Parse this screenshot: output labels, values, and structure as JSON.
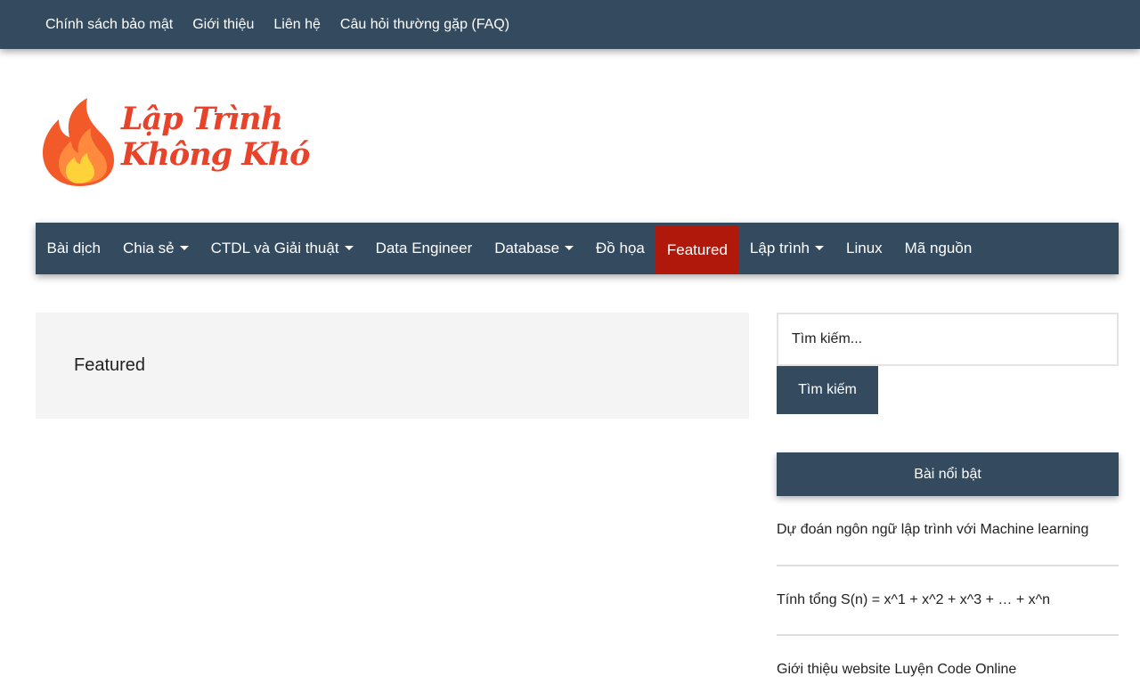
{
  "top_nav": [
    {
      "label": "Chính sách bảo mật"
    },
    {
      "label": "Giới thiệu"
    },
    {
      "label": "Liên hệ"
    },
    {
      "label": "Câu hỏi thường gặp (FAQ)"
    }
  ],
  "logo": {
    "line1": "Lập Trình",
    "line2": "Không Khó",
    "flame_colors": [
      "#f25a2a",
      "#ff8a3d",
      "#ffd23a"
    ]
  },
  "main_nav": {
    "active_color": "#b0180c",
    "bar_color": "#344a5e",
    "items": [
      {
        "label": "Bài dịch",
        "has_dropdown": false
      },
      {
        "label": "Chia sẻ",
        "has_dropdown": true
      },
      {
        "label": "CTDL và Giải thuật",
        "has_dropdown": true
      },
      {
        "label": "Data Engineer",
        "has_dropdown": false
      },
      {
        "label": "Database",
        "has_dropdown": true
      },
      {
        "label": "Đồ họa",
        "has_dropdown": false
      },
      {
        "label": "Featured",
        "has_dropdown": false,
        "active": true
      },
      {
        "label": "Lập trình",
        "has_dropdown": true
      },
      {
        "label": "Linux",
        "has_dropdown": false
      },
      {
        "label": "Mã nguồn",
        "has_dropdown": false
      }
    ]
  },
  "content": {
    "title": "Featured"
  },
  "sidebar": {
    "search": {
      "placeholder": "Tìm kiếm...",
      "button_label": "Tìm kiếm"
    },
    "widget_title": "Bài nổi bật",
    "posts": [
      {
        "title": "Dự đoán ngôn ngữ lập trình với Machine learning"
      },
      {
        "title": "Tính tổng S(n) = x^1 + x^2 + x^3 + … + x^n"
      },
      {
        "title": "Giới thiệu website Luyện Code Online"
      }
    ]
  }
}
